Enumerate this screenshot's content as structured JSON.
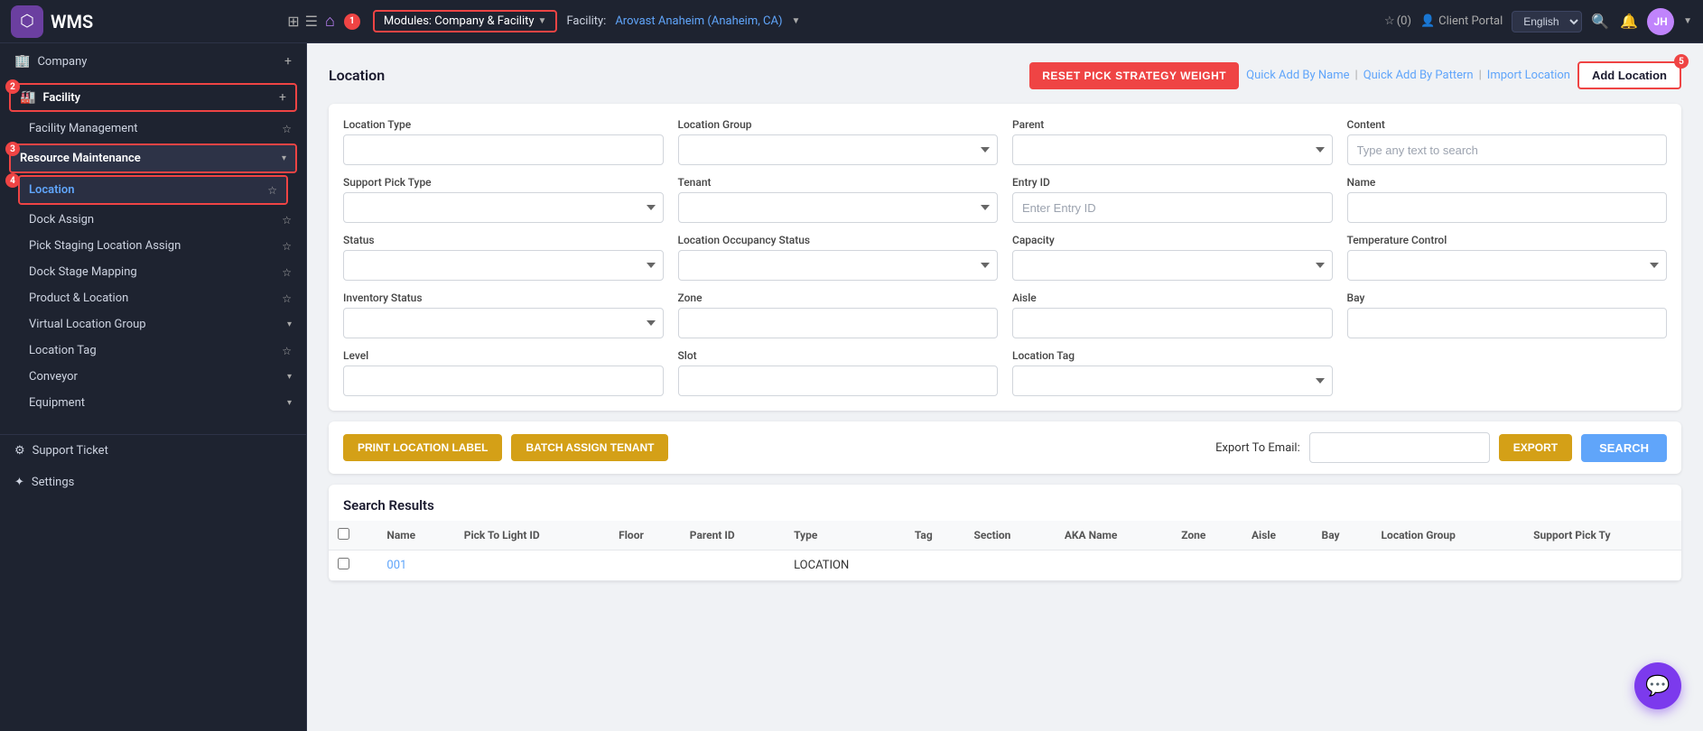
{
  "topbar": {
    "logo_text": "WMS",
    "module_label": "Modules:  Company & Facility",
    "facility_label": "Facility:",
    "facility_name": "Arovast Anaheim  (Anaheim, CA)",
    "star_count": "(0)",
    "client_portal": "Client Portal",
    "language": "English",
    "avatar_initials": "JH"
  },
  "sidebar": {
    "company_label": "Company",
    "facility_label": "Facility",
    "facility_management": "Facility Management",
    "resource_maintenance": "Resource Maintenance",
    "location_label": "Location",
    "dock_assign": "Dock Assign",
    "pick_staging": "Pick Staging Location Assign",
    "dock_stage_mapping": "Dock Stage Mapping",
    "product_location": "Product & Location",
    "virtual_location_group": "Virtual Location Group",
    "location_tag": "Location Tag",
    "conveyor": "Conveyor",
    "equipment": "Equipment",
    "support_ticket": "Support Ticket",
    "settings": "Settings"
  },
  "content": {
    "section_title": "Location",
    "btn_reset": "RESET PICK STRATEGY WEIGHT",
    "action_quick_add_name": "Quick Add By Name",
    "action_quick_add_pattern": "Quick Add By Pattern",
    "action_import": "Import Location",
    "action_add": "Add Location",
    "form": {
      "location_type_label": "Location Type",
      "location_group_label": "Location Group",
      "parent_label": "Parent",
      "content_label": "Content",
      "content_placeholder": "Type any text to search",
      "support_pick_type_label": "Support Pick Type",
      "tenant_label": "Tenant",
      "entry_id_label": "Entry ID",
      "entry_id_placeholder": "Enter Entry ID",
      "name_label": "Name",
      "status_label": "Status",
      "location_occupancy_label": "Location Occupancy Status",
      "capacity_label": "Capacity",
      "temperature_label": "Temperature Control",
      "inventory_status_label": "Inventory Status",
      "zone_label": "Zone",
      "aisle_label": "Aisle",
      "bay_label": "Bay",
      "level_label": "Level",
      "slot_label": "Slot",
      "location_tag_label": "Location Tag"
    },
    "btn_print": "PRINT LOCATION LABEL",
    "btn_batch": "BATCH ASSIGN TENANT",
    "export_label": "Export To Email:",
    "btn_export": "EXPORT",
    "btn_search": "SEARCH",
    "results_title": "Search Results",
    "table": {
      "columns": [
        "",
        "Name",
        "Pick To Light ID",
        "Floor",
        "Parent ID",
        "Type",
        "Tag",
        "Section",
        "AKA Name",
        "Zone",
        "Aisle",
        "Bay",
        "Location Group",
        "Support Pick Ty"
      ],
      "rows": [
        {
          "checkbox": false,
          "name": "001",
          "pick_light_id": "",
          "floor": "",
          "parent_id": "",
          "type": "LOCATION",
          "tag": "",
          "section": "",
          "aka_name": "",
          "zone": "",
          "aisle": "",
          "bay": "",
          "location_group": "",
          "support_pick_type": ""
        }
      ]
    }
  }
}
